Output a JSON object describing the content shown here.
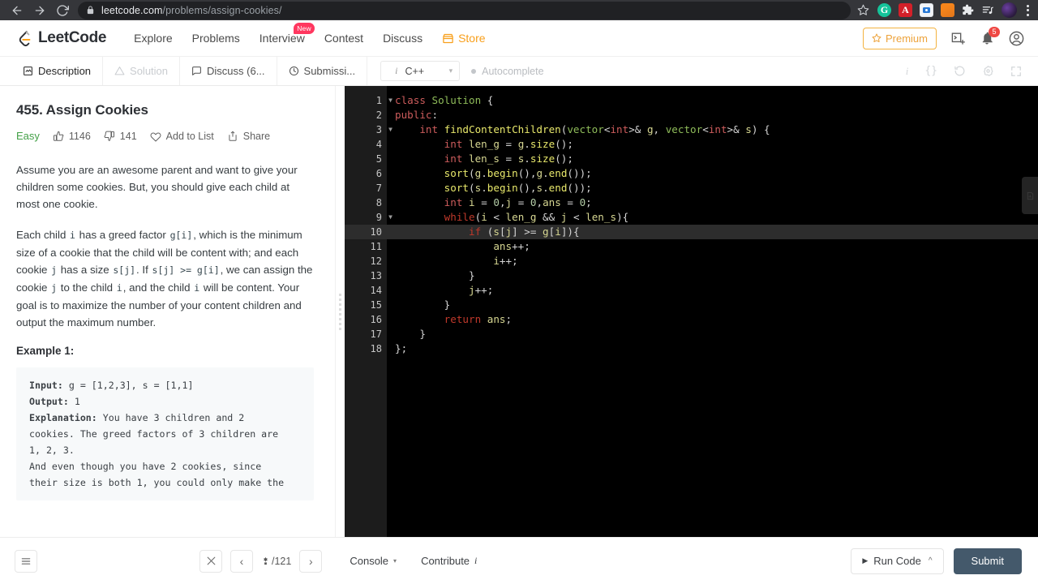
{
  "browser": {
    "url_domain": "leetcode.com",
    "url_path": "/problems/assign-cookies/",
    "back_icon": "back-arrow-icon",
    "forward_icon": "forward-arrow-icon",
    "reload_icon": "reload-icon",
    "lock_icon": "lock-icon",
    "star_icon": "bookmark-star-icon",
    "extensions": [
      {
        "name": "grammarly-extension-icon",
        "label": "G"
      },
      {
        "name": "adobe-acrobat-extension-icon",
        "label": "A"
      },
      {
        "name": "screen-recorder-extension-icon",
        "label": ""
      },
      {
        "name": "metamask-extension-icon",
        "label": ""
      },
      {
        "name": "extensions-puzzle-icon",
        "label": ""
      },
      {
        "name": "playlist-icon",
        "label": ""
      }
    ],
    "profile_icon": "browser-profile-avatar",
    "menu_icon": "chrome-menu-kebab-icon"
  },
  "header": {
    "brand": "LeetCode",
    "nav": [
      {
        "label": "Explore",
        "badge": null
      },
      {
        "label": "Problems",
        "badge": null
      },
      {
        "label": "Interview",
        "badge": "New"
      },
      {
        "label": "Contest",
        "badge": null
      },
      {
        "label": "Discuss",
        "badge": null
      },
      {
        "label": "Store",
        "badge": null
      }
    ],
    "premium_label": "Premium",
    "playground_icon": "playground-terminal-icon",
    "notification_icon": "bell-icon",
    "notification_count": "5",
    "avatar_icon": "user-avatar-icon"
  },
  "tabs": [
    {
      "label": "Description",
      "icon": "description-icon",
      "state": "active"
    },
    {
      "label": "Solution",
      "icon": "solution-flask-icon",
      "state": "disabled"
    },
    {
      "label": "Discuss (6...",
      "icon": "discuss-icon",
      "state": "normal"
    },
    {
      "label": "Submissi...",
      "icon": "submissions-clock-icon",
      "state": "normal"
    }
  ],
  "editor_toolbar": {
    "language": "C++",
    "language_info_icon": "info-italic-icon",
    "language_caret": "▾",
    "autocomplete_label": "Autocomplete",
    "right_icons": [
      {
        "name": "info-icon",
        "glyph": "i"
      },
      {
        "name": "format-braces-icon",
        "glyph": "{}"
      },
      {
        "name": "reset-code-icon",
        "glyph": "↺"
      },
      {
        "name": "settings-gear-icon",
        "glyph": "⚙"
      },
      {
        "name": "fullscreen-icon",
        "glyph": "⛶"
      }
    ]
  },
  "problem": {
    "title": "455. Assign Cookies",
    "difficulty": "Easy",
    "likes": "1146",
    "dislikes": "141",
    "add_to_list_label": "Add to List",
    "share_label": "Share",
    "paragraphs": [
      {
        "parts": [
          {
            "t": "text",
            "v": "Assume you are an awesome parent and want to give your children some cookies. But, you should give each child at most one cookie."
          }
        ]
      },
      {
        "parts": [
          {
            "t": "text",
            "v": "Each child "
          },
          {
            "t": "code",
            "v": "i"
          },
          {
            "t": "text",
            "v": " has a greed factor "
          },
          {
            "t": "code",
            "v": "g[i]"
          },
          {
            "t": "text",
            "v": ", which is the minimum size of a cookie that the child will be content with; and each cookie "
          },
          {
            "t": "code",
            "v": "j"
          },
          {
            "t": "text",
            "v": " has a size "
          },
          {
            "t": "code",
            "v": "s[j]"
          },
          {
            "t": "text",
            "v": ". If "
          },
          {
            "t": "code",
            "v": "s[j] >= g[i]"
          },
          {
            "t": "text",
            "v": ", we can assign the cookie "
          },
          {
            "t": "code",
            "v": "j"
          },
          {
            "t": "text",
            "v": " to the child "
          },
          {
            "t": "code",
            "v": "i"
          },
          {
            "t": "text",
            "v": ", and the child "
          },
          {
            "t": "code",
            "v": "i"
          },
          {
            "t": "text",
            "v": " will be content. Your goal is to maximize the number of your content children and output the maximum number."
          }
        ]
      }
    ],
    "example_heading": "Example 1:",
    "example_lines": [
      [
        {
          "t": "b",
          "v": "Input:"
        },
        {
          "t": "t",
          "v": " g = [1,2,3], s = [1,1]"
        }
      ],
      [
        {
          "t": "b",
          "v": "Output:"
        },
        {
          "t": "t",
          "v": " 1"
        }
      ],
      [
        {
          "t": "b",
          "v": "Explanation:"
        },
        {
          "t": "t",
          "v": " You have 3 children and 2"
        }
      ],
      [
        {
          "t": "t",
          "v": "cookies. The greed factors of 3 children are"
        }
      ],
      [
        {
          "t": "t",
          "v": "1, 2, 3."
        }
      ],
      [
        {
          "t": "t",
          "v": "And even though you have 2 cookies, since"
        }
      ],
      [
        {
          "t": "t",
          "v": "their size is both 1, you could only make the"
        }
      ]
    ]
  },
  "code": {
    "active_line": 10,
    "fold_lines": [
      1,
      3,
      9,
      10
    ],
    "lines": [
      {
        "n": 1,
        "tokens": [
          {
            "c": "tk-key",
            "v": "class"
          },
          {
            "c": "tk-plain",
            "v": " "
          },
          {
            "c": "tk-type",
            "v": "Solution"
          },
          {
            "c": "tk-plain",
            "v": " {"
          }
        ]
      },
      {
        "n": 2,
        "tokens": [
          {
            "c": "tk-key",
            "v": "public"
          },
          {
            "c": "tk-plain",
            "v": ":"
          }
        ]
      },
      {
        "n": 3,
        "tokens": [
          {
            "c": "tk-plain",
            "v": "    "
          },
          {
            "c": "tk-key",
            "v": "int"
          },
          {
            "c": "tk-plain",
            "v": " "
          },
          {
            "c": "tk-fn",
            "v": "findContentChildren"
          },
          {
            "c": "tk-plain",
            "v": "("
          },
          {
            "c": "tk-type",
            "v": "vector"
          },
          {
            "c": "tk-plain",
            "v": "<"
          },
          {
            "c": "tk-key",
            "v": "int"
          },
          {
            "c": "tk-plain",
            "v": ">& "
          },
          {
            "c": "tk-var",
            "v": "g"
          },
          {
            "c": "tk-plain",
            "v": ", "
          },
          {
            "c": "tk-type",
            "v": "vector"
          },
          {
            "c": "tk-plain",
            "v": "<"
          },
          {
            "c": "tk-key",
            "v": "int"
          },
          {
            "c": "tk-plain",
            "v": ">& "
          },
          {
            "c": "tk-var",
            "v": "s"
          },
          {
            "c": "tk-plain",
            "v": ") {"
          }
        ]
      },
      {
        "n": 4,
        "tokens": [
          {
            "c": "tk-plain",
            "v": "        "
          },
          {
            "c": "tk-key",
            "v": "int"
          },
          {
            "c": "tk-plain",
            "v": " "
          },
          {
            "c": "tk-var",
            "v": "len_g"
          },
          {
            "c": "tk-plain",
            "v": " = "
          },
          {
            "c": "tk-var",
            "v": "g"
          },
          {
            "c": "tk-plain",
            "v": "."
          },
          {
            "c": "tk-fn",
            "v": "size"
          },
          {
            "c": "tk-plain",
            "v": "();"
          }
        ]
      },
      {
        "n": 5,
        "tokens": [
          {
            "c": "tk-plain",
            "v": "        "
          },
          {
            "c": "tk-key",
            "v": "int"
          },
          {
            "c": "tk-plain",
            "v": " "
          },
          {
            "c": "tk-var",
            "v": "len_s"
          },
          {
            "c": "tk-plain",
            "v": " = "
          },
          {
            "c": "tk-var",
            "v": "s"
          },
          {
            "c": "tk-plain",
            "v": "."
          },
          {
            "c": "tk-fn",
            "v": "size"
          },
          {
            "c": "tk-plain",
            "v": "();"
          }
        ]
      },
      {
        "n": 6,
        "tokens": [
          {
            "c": "tk-plain",
            "v": "        "
          },
          {
            "c": "tk-fn",
            "v": "sort"
          },
          {
            "c": "tk-plain",
            "v": "("
          },
          {
            "c": "tk-var",
            "v": "g"
          },
          {
            "c": "tk-plain",
            "v": "."
          },
          {
            "c": "tk-fn",
            "v": "begin"
          },
          {
            "c": "tk-plain",
            "v": "(),"
          },
          {
            "c": "tk-var",
            "v": "g"
          },
          {
            "c": "tk-plain",
            "v": "."
          },
          {
            "c": "tk-fn",
            "v": "end"
          },
          {
            "c": "tk-plain",
            "v": "());"
          }
        ]
      },
      {
        "n": 7,
        "tokens": [
          {
            "c": "tk-plain",
            "v": "        "
          },
          {
            "c": "tk-fn",
            "v": "sort"
          },
          {
            "c": "tk-plain",
            "v": "("
          },
          {
            "c": "tk-var",
            "v": "s"
          },
          {
            "c": "tk-plain",
            "v": "."
          },
          {
            "c": "tk-fn",
            "v": "begin"
          },
          {
            "c": "tk-plain",
            "v": "(),"
          },
          {
            "c": "tk-var",
            "v": "s"
          },
          {
            "c": "tk-plain",
            "v": "."
          },
          {
            "c": "tk-fn",
            "v": "end"
          },
          {
            "c": "tk-plain",
            "v": "());"
          }
        ]
      },
      {
        "n": 8,
        "tokens": [
          {
            "c": "tk-plain",
            "v": "        "
          },
          {
            "c": "tk-key",
            "v": "int"
          },
          {
            "c": "tk-plain",
            "v": " "
          },
          {
            "c": "tk-var",
            "v": "i"
          },
          {
            "c": "tk-plain",
            "v": " = "
          },
          {
            "c": "tk-num",
            "v": "0"
          },
          {
            "c": "tk-plain",
            "v": ","
          },
          {
            "c": "tk-var",
            "v": "j"
          },
          {
            "c": "tk-plain",
            "v": " = "
          },
          {
            "c": "tk-num",
            "v": "0"
          },
          {
            "c": "tk-plain",
            "v": ","
          },
          {
            "c": "tk-var",
            "v": "ans"
          },
          {
            "c": "tk-plain",
            "v": " = "
          },
          {
            "c": "tk-num",
            "v": "0"
          },
          {
            "c": "tk-plain",
            "v": ";"
          }
        ]
      },
      {
        "n": 9,
        "tokens": [
          {
            "c": "tk-plain",
            "v": "        "
          },
          {
            "c": "tk-kw2",
            "v": "while"
          },
          {
            "c": "tk-plain",
            "v": "("
          },
          {
            "c": "tk-var",
            "v": "i"
          },
          {
            "c": "tk-plain",
            "v": " < "
          },
          {
            "c": "tk-var",
            "v": "len_g"
          },
          {
            "c": "tk-plain",
            "v": " && "
          },
          {
            "c": "tk-var",
            "v": "j"
          },
          {
            "c": "tk-plain",
            "v": " < "
          },
          {
            "c": "tk-var",
            "v": "len_s"
          },
          {
            "c": "tk-plain",
            "v": "){"
          }
        ]
      },
      {
        "n": 10,
        "tokens": [
          {
            "c": "tk-plain",
            "v": "            "
          },
          {
            "c": "tk-kw2",
            "v": "if"
          },
          {
            "c": "tk-plain",
            "v": " ("
          },
          {
            "c": "tk-var",
            "v": "s"
          },
          {
            "c": "tk-plain",
            "v": "["
          },
          {
            "c": "tk-var",
            "v": "j"
          },
          {
            "c": "tk-plain",
            "v": "] >= "
          },
          {
            "c": "tk-var",
            "v": "g"
          },
          {
            "c": "tk-plain",
            "v": "["
          },
          {
            "c": "tk-var",
            "v": "i"
          },
          {
            "c": "tk-plain",
            "v": "]){"
          }
        ]
      },
      {
        "n": 11,
        "tokens": [
          {
            "c": "tk-plain",
            "v": "                "
          },
          {
            "c": "tk-var",
            "v": "ans"
          },
          {
            "c": "tk-plain",
            "v": "++;"
          }
        ]
      },
      {
        "n": 12,
        "tokens": [
          {
            "c": "tk-plain",
            "v": "                "
          },
          {
            "c": "tk-var",
            "v": "i"
          },
          {
            "c": "tk-plain",
            "v": "++;"
          }
        ]
      },
      {
        "n": 13,
        "tokens": [
          {
            "c": "tk-plain",
            "v": "            }"
          }
        ]
      },
      {
        "n": 14,
        "tokens": [
          {
            "c": "tk-plain",
            "v": "            "
          },
          {
            "c": "tk-var",
            "v": "j"
          },
          {
            "c": "tk-plain",
            "v": "++;"
          }
        ]
      },
      {
        "n": 15,
        "tokens": [
          {
            "c": "tk-plain",
            "v": "        }"
          }
        ]
      },
      {
        "n": 16,
        "tokens": [
          {
            "c": "tk-plain",
            "v": "        "
          },
          {
            "c": "tk-kw2",
            "v": "return"
          },
          {
            "c": "tk-plain",
            "v": " "
          },
          {
            "c": "tk-var",
            "v": "ans"
          },
          {
            "c": "tk-plain",
            "v": ";"
          }
        ]
      },
      {
        "n": 17,
        "tokens": [
          {
            "c": "tk-plain",
            "v": "    }"
          }
        ]
      },
      {
        "n": 18,
        "tokens": [
          {
            "c": "tk-plain",
            "v": "};"
          }
        ]
      }
    ]
  },
  "bottom": {
    "list_icon": "problem-list-icon",
    "shuffle_icon": "shuffle-icon",
    "prev_label": "‹",
    "next_label": "›",
    "page_icon": "random-pick-icon",
    "page_count": "/121",
    "console_label": "Console",
    "console_caret": "▾",
    "contribute_label": "Contribute",
    "run_label": "Run Code",
    "run_caret": "^",
    "submit_label": "Submit"
  },
  "colors": {
    "accent_orange": "#f89f1b",
    "easy_green": "#43a047",
    "submit_slate": "#44596b",
    "badge_red": "#ff375f",
    "editor_bg": "#000000"
  }
}
